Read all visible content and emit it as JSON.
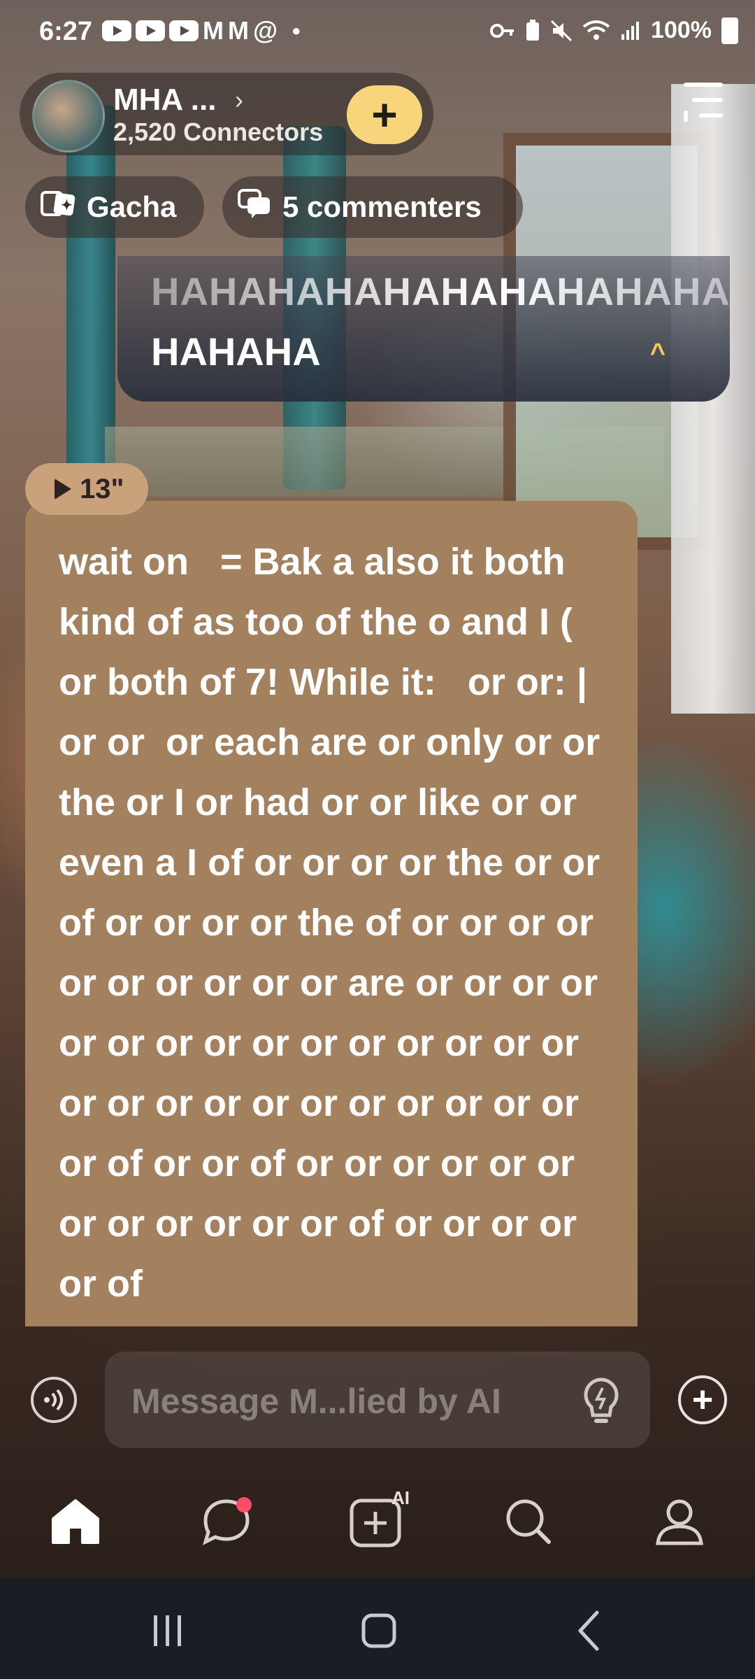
{
  "status_bar": {
    "time": "6:27",
    "notification_icons": [
      "youtube-icon",
      "youtube-icon",
      "youtube-icon",
      "gmail-icon",
      "gmail-icon",
      "threads-icon",
      "dot-icon"
    ],
    "right_icons": [
      "key-icon",
      "battery-saver-icon",
      "mute-icon",
      "wifi-icon",
      "signal-icon"
    ],
    "battery": "100%"
  },
  "header": {
    "community_name": "MHA ...",
    "connectors": "2,520 Connectors",
    "add_label": "+",
    "chips": [
      {
        "label": "Gacha",
        "icon": "gacha-cards-icon"
      },
      {
        "label": "5 commenters",
        "icon": "comments-icon"
      }
    ]
  },
  "announcement": {
    "line1": "HAHAHAHAHAHAHAHAHAHA",
    "line2": "HAHAHA",
    "collapse_icon": "^"
  },
  "message": {
    "duration": "13\"",
    "text": "wait on   = Bak a also it both kind of as too of the o and I ( or both of 7! While it:   or or: | or or  or each are or only or or the or I or had or or like or or even a I of or or or or the or or of or or or or the of or or or or or or or or or or are or or or or or or or or or or or or or or or or or or or or or or or or or or or of or or of or or or or or or or or or or or or of or or or or or of"
  },
  "composer": {
    "placeholder": "Message M...lied by AI"
  },
  "bottom_nav": {
    "items": [
      "home",
      "chats",
      "create-ai",
      "search",
      "profile"
    ],
    "ai_label": "AI",
    "accent": "#ff4d67"
  },
  "colors": {
    "bubble": "#a3815f",
    "add_button": "#f8d57a",
    "announcement_bg": "#2e3442"
  }
}
